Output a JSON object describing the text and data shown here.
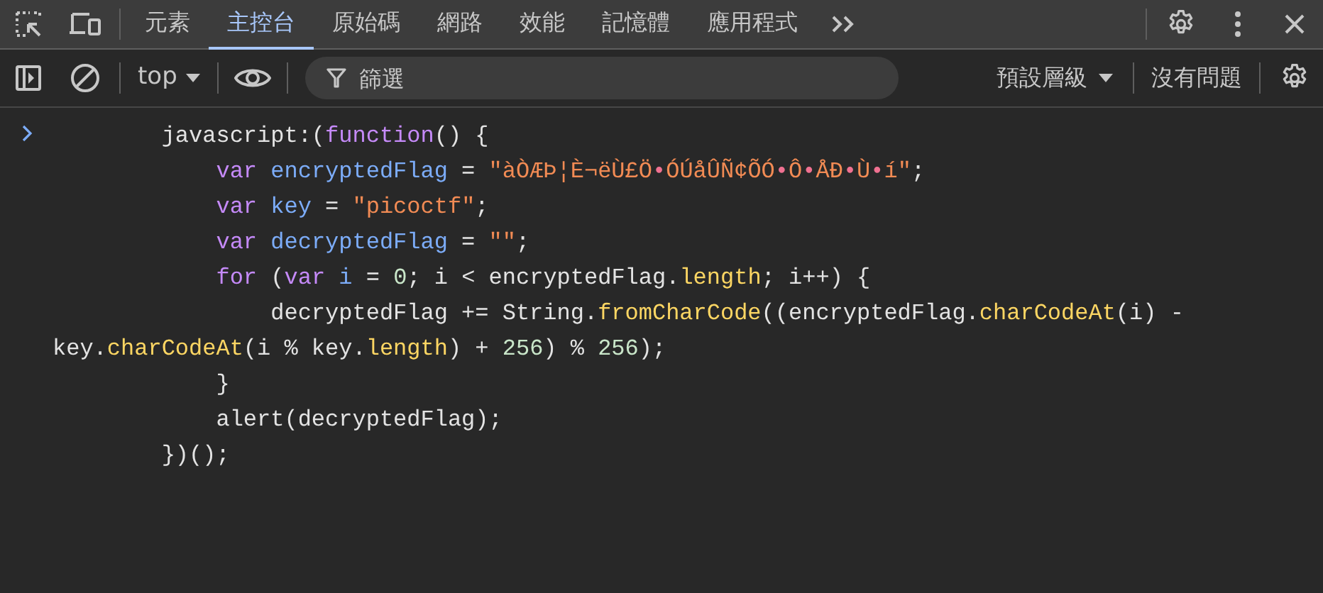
{
  "main_toolbar": {
    "tabs": [
      {
        "label": "元素",
        "selected": false
      },
      {
        "label": "主控台",
        "selected": true
      },
      {
        "label": "原始碼",
        "selected": false
      },
      {
        "label": "網路",
        "selected": false
      },
      {
        "label": "效能",
        "selected": false
      },
      {
        "label": "記憶體",
        "selected": false
      },
      {
        "label": "應用程式",
        "selected": false
      }
    ]
  },
  "console_toolbar": {
    "context": "top",
    "filter": {
      "placeholder": "篩選"
    },
    "levels": "預設層級",
    "issues": "沒有問題"
  },
  "console": {
    "lines": [
      {
        "tokens": [
          {
            "kind": "plain",
            "text": "        javascript:("
          },
          {
            "kind": "keyword",
            "text": "function"
          },
          {
            "kind": "plain",
            "text": "() {"
          }
        ]
      },
      {
        "tokens": [
          {
            "kind": "keyword",
            "text": "            var"
          },
          {
            "kind": "variable",
            "text": " encryptedFlag"
          },
          {
            "kind": "plain",
            "text": " = "
          },
          {
            "kind": "string",
            "text": "\"àÒÆÞ¦È¬ëÙ£Ö"
          },
          {
            "kind": "control",
            "text": "•"
          },
          {
            "kind": "string",
            "text": "ÓÚåÛÑ¢ÕÓ"
          },
          {
            "kind": "control",
            "text": "•"
          },
          {
            "kind": "string",
            "text": "Ô"
          },
          {
            "kind": "control",
            "text": "•"
          },
          {
            "kind": "string",
            "text": "ÅÐ"
          },
          {
            "kind": "control",
            "text": "•"
          },
          {
            "kind": "string",
            "text": "Ù"
          },
          {
            "kind": "control",
            "text": "•"
          },
          {
            "kind": "string",
            "text": "í\""
          },
          {
            "kind": "plain",
            "text": ";"
          }
        ]
      },
      {
        "tokens": [
          {
            "kind": "keyword",
            "text": "            var"
          },
          {
            "kind": "variable",
            "text": " key"
          },
          {
            "kind": "plain",
            "text": " = "
          },
          {
            "kind": "string",
            "text": "\"picoctf\""
          },
          {
            "kind": "plain",
            "text": ";"
          }
        ]
      },
      {
        "tokens": [
          {
            "kind": "keyword",
            "text": "            var"
          },
          {
            "kind": "variable",
            "text": " decryptedFlag"
          },
          {
            "kind": "plain",
            "text": " = "
          },
          {
            "kind": "string",
            "text": "\"\""
          },
          {
            "kind": "plain",
            "text": ";"
          }
        ]
      },
      {
        "tokens": [
          {
            "kind": "keyword",
            "text": "            for"
          },
          {
            "kind": "plain",
            "text": " ("
          },
          {
            "kind": "keyword",
            "text": "var"
          },
          {
            "kind": "variable",
            "text": " i"
          },
          {
            "kind": "plain",
            "text": " = "
          },
          {
            "kind": "number",
            "text": "0"
          },
          {
            "kind": "plain",
            "text": "; i < encryptedFlag."
          },
          {
            "kind": "method",
            "text": "length"
          },
          {
            "kind": "plain",
            "text": "; i++) {"
          }
        ]
      },
      {
        "tokens": [
          {
            "kind": "plain",
            "text": "                decryptedFlag += String."
          },
          {
            "kind": "method",
            "text": "fromCharCode"
          },
          {
            "kind": "plain",
            "text": "((encryptedFlag."
          },
          {
            "kind": "method",
            "text": "charCodeAt"
          },
          {
            "kind": "plain",
            "text": "(i) - key."
          },
          {
            "kind": "method",
            "text": "charCodeAt"
          },
          {
            "kind": "plain",
            "text": "(i % key."
          },
          {
            "kind": "method",
            "text": "length"
          },
          {
            "kind": "plain",
            "text": ") + "
          },
          {
            "kind": "number",
            "text": "256"
          },
          {
            "kind": "plain",
            "text": ") % "
          },
          {
            "kind": "number",
            "text": "256"
          },
          {
            "kind": "plain",
            "text": ");"
          }
        ]
      },
      {
        "tokens": [
          {
            "kind": "plain",
            "text": "            }"
          }
        ]
      },
      {
        "tokens": [
          {
            "kind": "plain",
            "text": "            alert(decryptedFlag);"
          }
        ]
      },
      {
        "tokens": [
          {
            "kind": "plain",
            "text": "        })();"
          }
        ]
      }
    ]
  }
}
